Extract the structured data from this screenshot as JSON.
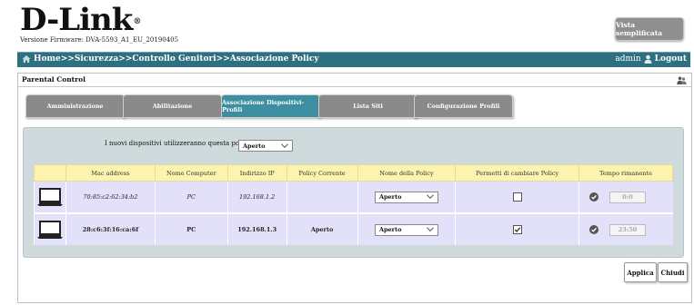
{
  "brand": {
    "name": "D-Link",
    "reg": "®"
  },
  "firmware_text": "Versione Firmware: DVA-5593_A1_EU_20190405",
  "simple_view_label": "Vista semplificata",
  "nav": {
    "breadcrumb": "Home>>Sicurezza>>Controllo Genitori>>Associazione Policy",
    "user": "admin",
    "logout": "Logout"
  },
  "panel": {
    "title": "Parental Control"
  },
  "tabs": [
    {
      "label": "Amministrazione",
      "active": false
    },
    {
      "label": "Abilitazione",
      "active": false
    },
    {
      "label": "Associazione Dispositivi-Profili",
      "active": true
    },
    {
      "label": "Lista Siti",
      "active": false
    },
    {
      "label": "Configurazione Profili",
      "active": false
    }
  ],
  "new_devices": {
    "label": "I nuovi dispositivi utilizzeranno questa policy:",
    "value": "Aperto"
  },
  "table": {
    "headers": [
      "",
      "Mac address",
      "Nome Computer",
      "Indirizzo IP",
      "Policy Corrente",
      "Nome della Policy",
      "Permetti di cambiare Policy",
      "Tempo rimanente"
    ],
    "rows": [
      {
        "mac": "70:85:c2:62:34:b2",
        "name": "PC",
        "ip": "192.168.1.2",
        "current": "",
        "policy": "Aperto",
        "allow_change": false,
        "time": "0:0"
      },
      {
        "mac": "28:c6:3f:16:ca:6f",
        "name": "PC",
        "ip": "192.168.1.3",
        "current": "Aperto",
        "policy": "Aperto",
        "allow_change": true,
        "time": "23:50"
      }
    ]
  },
  "buttons": {
    "apply": "Applica",
    "close": "Chiudi"
  },
  "colors": {
    "nav": "#2e6f82",
    "active_tab": "#3d8ea0",
    "inactive_tab": "#8a8a8a",
    "content_bg": "#cfdadd",
    "header_bg": "#fcf3b0",
    "row_bg": "#e3e1fa"
  }
}
